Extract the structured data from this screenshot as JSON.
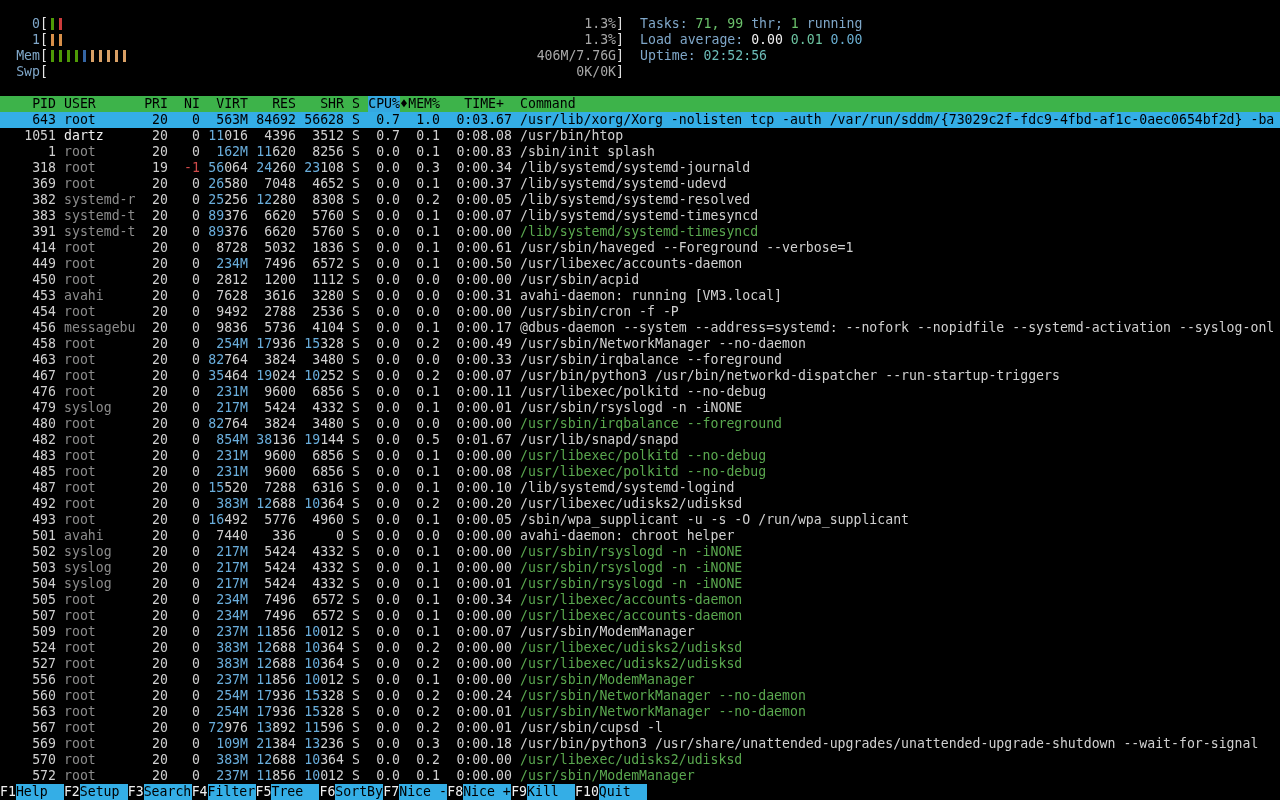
{
  "meters": [
    {
      "label": "0",
      "bars": [
        {
          "color": "#4e9a06"
        },
        {
          "color": "#cc3b3b"
        }
      ],
      "reading": "1.3%"
    },
    {
      "label": "1",
      "bars": [
        {
          "color": "#d9904a"
        },
        {
          "color": "#d9904a"
        }
      ],
      "reading": "1.3%"
    },
    {
      "label": "Mem",
      "bars": [
        {
          "color": "#4e9a06"
        },
        {
          "color": "#4e9a06"
        },
        {
          "color": "#4e9a06"
        },
        {
          "color": "#4e9a06"
        },
        {
          "color": "#3465a4"
        },
        {
          "color": "#d9a066"
        },
        {
          "color": "#d9a066"
        },
        {
          "color": "#d9a066"
        },
        {
          "color": "#d9a066"
        },
        {
          "color": "#d9a066"
        }
      ],
      "reading": "406M/7.76G"
    },
    {
      "label": "Swp",
      "reading": "0K/0K"
    }
  ],
  "bracket_open": "[",
  "bracket_close": "]",
  "stats": [
    [
      {
        "text": "Tasks: ",
        "color": "#7fa7c9"
      },
      {
        "text": "71, 99",
        "color": "#6cc36c"
      },
      {
        "text": " thr; ",
        "color": "#7fa7c9"
      },
      {
        "text": "1",
        "color": "#6cc36c"
      },
      {
        "text": " running",
        "color": "#7fa7c9"
      }
    ],
    [
      {
        "text": "Load average: ",
        "color": "#7fa7c9"
      },
      {
        "text": "0.00 ",
        "color": "#f0f0f0"
      },
      {
        "text": "0.01 ",
        "color": "#6cc3a0"
      },
      {
        "text": "0.00",
        "color": "#6aaed0"
      }
    ],
    [
      {
        "text": "Uptime: ",
        "color": "#7fa7c9"
      },
      {
        "text": "02:52:56",
        "color": "#6cbcb8"
      }
    ]
  ],
  "columns": [
    {
      "label": "PID",
      "sorted": false
    },
    {
      "label": "USER",
      "sorted": false
    },
    {
      "label": "PRI",
      "sorted": false
    },
    {
      "label": "NI",
      "sorted": false
    },
    {
      "label": "VIRT",
      "sorted": false
    },
    {
      "label": "RES",
      "sorted": false
    },
    {
      "label": "SHR",
      "sorted": false
    },
    {
      "label": "S",
      "sorted": false
    },
    {
      "label": "CPU%",
      "sorted": true
    },
    {
      "label": "MEM%",
      "sorted": false
    },
    {
      "label": "TIME+",
      "sorted": false
    },
    {
      "label": "Command",
      "sorted": false
    }
  ],
  "sort_indicator": "♦",
  "rows": [
    {
      "cells": [
        "643",
        "root",
        "20",
        "0",
        "563M",
        "84692",
        "56628",
        "S",
        "0.7",
        "1.0",
        "0:03.67",
        "/usr/lib/xorg/Xorg -nolisten tcp -auth /var/run/sddm/{73029c2f-fdc9-4fbd-af1c-0aec0654bf2d} -ba"
      ],
      "selected": true
    },
    {
      "cells": [
        "1051",
        "dartz",
        "20",
        "0",
        "11016",
        "4396",
        "3512",
        "S",
        "0.7",
        "0.1",
        "0:08.08",
        "/usr/bin/htop"
      ],
      "selected": false,
      "own": true,
      "thread": false,
      "niced": false
    },
    {
      "cells": [
        "1",
        "root",
        "20",
        "0",
        "162M",
        "11620",
        "8256",
        "S",
        "0.0",
        "0.1",
        "0:00.83",
        "/sbin/init splash"
      ],
      "selected": false,
      "own": false,
      "thread": false,
      "niced": false
    },
    {
      "cells": [
        "318",
        "root",
        "19",
        "-1",
        "56064",
        "24260",
        "23108",
        "S",
        "0.0",
        "0.3",
        "0:00.34",
        "/lib/systemd/systemd-journald"
      ],
      "selected": false,
      "own": false,
      "thread": false,
      "niced": true
    },
    {
      "cells": [
        "369",
        "root",
        "20",
        "0",
        "26580",
        "7048",
        "4652",
        "S",
        "0.0",
        "0.1",
        "0:00.37",
        "/lib/systemd/systemd-udevd"
      ],
      "selected": false,
      "own": false,
      "thread": false,
      "niced": false
    },
    {
      "cells": [
        "382",
        "systemd-r",
        "20",
        "0",
        "25256",
        "12280",
        "8308",
        "S",
        "0.0",
        "0.2",
        "0:00.05",
        "/lib/systemd/systemd-resolved"
      ],
      "selected": false,
      "own": false,
      "thread": false,
      "niced": false
    },
    {
      "cells": [
        "383",
        "systemd-t",
        "20",
        "0",
        "89376",
        "6620",
        "5760",
        "S",
        "0.0",
        "0.1",
        "0:00.07",
        "/lib/systemd/systemd-timesyncd"
      ],
      "selected": false,
      "own": false,
      "thread": false,
      "niced": false
    },
    {
      "cells": [
        "391",
        "systemd-t",
        "20",
        "0",
        "89376",
        "6620",
        "5760",
        "S",
        "0.0",
        "0.1",
        "0:00.00",
        "/lib/systemd/systemd-timesyncd"
      ],
      "selected": false,
      "own": false,
      "thread": true,
      "niced": false
    },
    {
      "cells": [
        "414",
        "root",
        "20",
        "0",
        "8728",
        "5032",
        "1836",
        "S",
        "0.0",
        "0.1",
        "0:00.61",
        "/usr/sbin/haveged --Foreground --verbose=1"
      ],
      "selected": false,
      "own": false,
      "thread": false,
      "niced": false
    },
    {
      "cells": [
        "449",
        "root",
        "20",
        "0",
        "234M",
        "7496",
        "6572",
        "S",
        "0.0",
        "0.1",
        "0:00.50",
        "/usr/libexec/accounts-daemon"
      ],
      "selected": false,
      "own": false,
      "thread": false,
      "niced": false
    },
    {
      "cells": [
        "450",
        "root",
        "20",
        "0",
        "2812",
        "1200",
        "1112",
        "S",
        "0.0",
        "0.0",
        "0:00.00",
        "/usr/sbin/acpid"
      ],
      "selected": false,
      "own": false,
      "thread": false,
      "niced": false
    },
    {
      "cells": [
        "453",
        "avahi",
        "20",
        "0",
        "7628",
        "3616",
        "3280",
        "S",
        "0.0",
        "0.0",
        "0:00.31",
        "avahi-daemon: running [VM3.local]"
      ],
      "selected": false,
      "own": false,
      "thread": false,
      "niced": false
    },
    {
      "cells": [
        "454",
        "root",
        "20",
        "0",
        "9492",
        "2788",
        "2536",
        "S",
        "0.0",
        "0.0",
        "0:00.00",
        "/usr/sbin/cron -f -P"
      ],
      "selected": false,
      "own": false,
      "thread": false,
      "niced": false
    },
    {
      "cells": [
        "456",
        "messagebu",
        "20",
        "0",
        "9836",
        "5736",
        "4104",
        "S",
        "0.0",
        "0.1",
        "0:00.17",
        "@dbus-daemon --system --address=systemd: --nofork --nopidfile --systemd-activation --syslog-onl"
      ],
      "selected": false,
      "own": false,
      "thread": false,
      "niced": false
    },
    {
      "cells": [
        "458",
        "root",
        "20",
        "0",
        "254M",
        "17936",
        "15328",
        "S",
        "0.0",
        "0.2",
        "0:00.49",
        "/usr/sbin/NetworkManager --no-daemon"
      ],
      "selected": false,
      "own": false,
      "thread": false,
      "niced": false
    },
    {
      "cells": [
        "463",
        "root",
        "20",
        "0",
        "82764",
        "3824",
        "3480",
        "S",
        "0.0",
        "0.0",
        "0:00.33",
        "/usr/sbin/irqbalance --foreground"
      ],
      "selected": false,
      "own": false,
      "thread": false,
      "niced": false
    },
    {
      "cells": [
        "467",
        "root",
        "20",
        "0",
        "35464",
        "19024",
        "10252",
        "S",
        "0.0",
        "0.2",
        "0:00.07",
        "/usr/bin/python3 /usr/bin/networkd-dispatcher --run-startup-triggers"
      ],
      "selected": false,
      "own": false,
      "thread": false,
      "niced": false
    },
    {
      "cells": [
        "476",
        "root",
        "20",
        "0",
        "231M",
        "9600",
        "6856",
        "S",
        "0.0",
        "0.1",
        "0:00.11",
        "/usr/libexec/polkitd --no-debug"
      ],
      "selected": false,
      "own": false,
      "thread": false,
      "niced": false
    },
    {
      "cells": [
        "479",
        "syslog",
        "20",
        "0",
        "217M",
        "5424",
        "4332",
        "S",
        "0.0",
        "0.1",
        "0:00.01",
        "/usr/sbin/rsyslogd -n -iNONE"
      ],
      "selected": false,
      "own": false,
      "thread": false,
      "niced": false
    },
    {
      "cells": [
        "480",
        "root",
        "20",
        "0",
        "82764",
        "3824",
        "3480",
        "S",
        "0.0",
        "0.0",
        "0:00.00",
        "/usr/sbin/irqbalance --foreground"
      ],
      "selected": false,
      "own": false,
      "thread": true,
      "niced": false
    },
    {
      "cells": [
        "482",
        "root",
        "20",
        "0",
        "854M",
        "38136",
        "19144",
        "S",
        "0.0",
        "0.5",
        "0:01.67",
        "/usr/lib/snapd/snapd"
      ],
      "selected": false,
      "own": false,
      "thread": false,
      "niced": false
    },
    {
      "cells": [
        "483",
        "root",
        "20",
        "0",
        "231M",
        "9600",
        "6856",
        "S",
        "0.0",
        "0.1",
        "0:00.00",
        "/usr/libexec/polkitd --no-debug"
      ],
      "selected": false,
      "own": false,
      "thread": true,
      "niced": false
    },
    {
      "cells": [
        "485",
        "root",
        "20",
        "0",
        "231M",
        "9600",
        "6856",
        "S",
        "0.0",
        "0.1",
        "0:00.08",
        "/usr/libexec/polkitd --no-debug"
      ],
      "selected": false,
      "own": false,
      "thread": true,
      "niced": false
    },
    {
      "cells": [
        "487",
        "root",
        "20",
        "0",
        "15520",
        "7288",
        "6316",
        "S",
        "0.0",
        "0.1",
        "0:00.10",
        "/lib/systemd/systemd-logind"
      ],
      "selected": false,
      "own": false,
      "thread": false,
      "niced": false
    },
    {
      "cells": [
        "492",
        "root",
        "20",
        "0",
        "383M",
        "12688",
        "10364",
        "S",
        "0.0",
        "0.2",
        "0:00.20",
        "/usr/libexec/udisks2/udisksd"
      ],
      "selected": false,
      "own": false,
      "thread": false,
      "niced": false
    },
    {
      "cells": [
        "493",
        "root",
        "20",
        "0",
        "16492",
        "5776",
        "4960",
        "S",
        "0.0",
        "0.1",
        "0:00.05",
        "/sbin/wpa_supplicant -u -s -O /run/wpa_supplicant"
      ],
      "selected": false,
      "own": false,
      "thread": false,
      "niced": false
    },
    {
      "cells": [
        "501",
        "avahi",
        "20",
        "0",
        "7440",
        "336",
        "0",
        "S",
        "0.0",
        "0.0",
        "0:00.00",
        "avahi-daemon: chroot helper"
      ],
      "selected": false,
      "own": false,
      "thread": false,
      "niced": false
    },
    {
      "cells": [
        "502",
        "syslog",
        "20",
        "0",
        "217M",
        "5424",
        "4332",
        "S",
        "0.0",
        "0.1",
        "0:00.00",
        "/usr/sbin/rsyslogd -n -iNONE"
      ],
      "selected": false,
      "own": false,
      "thread": true,
      "niced": false
    },
    {
      "cells": [
        "503",
        "syslog",
        "20",
        "0",
        "217M",
        "5424",
        "4332",
        "S",
        "0.0",
        "0.1",
        "0:00.00",
        "/usr/sbin/rsyslogd -n -iNONE"
      ],
      "selected": false,
      "own": false,
      "thread": true,
      "niced": false
    },
    {
      "cells": [
        "504",
        "syslog",
        "20",
        "0",
        "217M",
        "5424",
        "4332",
        "S",
        "0.0",
        "0.1",
        "0:00.01",
        "/usr/sbin/rsyslogd -n -iNONE"
      ],
      "selected": false,
      "own": false,
      "thread": true,
      "niced": false
    },
    {
      "cells": [
        "505",
        "root",
        "20",
        "0",
        "234M",
        "7496",
        "6572",
        "S",
        "0.0",
        "0.1",
        "0:00.34",
        "/usr/libexec/accounts-daemon"
      ],
      "selected": false,
      "own": false,
      "thread": true,
      "niced": false
    },
    {
      "cells": [
        "507",
        "root",
        "20",
        "0",
        "234M",
        "7496",
        "6572",
        "S",
        "0.0",
        "0.1",
        "0:00.00",
        "/usr/libexec/accounts-daemon"
      ],
      "selected": false,
      "own": false,
      "thread": true,
      "niced": false
    },
    {
      "cells": [
        "509",
        "root",
        "20",
        "0",
        "237M",
        "11856",
        "10012",
        "S",
        "0.0",
        "0.1",
        "0:00.07",
        "/usr/sbin/ModemManager"
      ],
      "selected": false,
      "own": false,
      "thread": false,
      "niced": false
    },
    {
      "cells": [
        "524",
        "root",
        "20",
        "0",
        "383M",
        "12688",
        "10364",
        "S",
        "0.0",
        "0.2",
        "0:00.00",
        "/usr/libexec/udisks2/udisksd"
      ],
      "selected": false,
      "own": false,
      "thread": true,
      "niced": false
    },
    {
      "cells": [
        "527",
        "root",
        "20",
        "0",
        "383M",
        "12688",
        "10364",
        "S",
        "0.0",
        "0.2",
        "0:00.00",
        "/usr/libexec/udisks2/udisksd"
      ],
      "selected": false,
      "own": false,
      "thread": true,
      "niced": false
    },
    {
      "cells": [
        "556",
        "root",
        "20",
        "0",
        "237M",
        "11856",
        "10012",
        "S",
        "0.0",
        "0.1",
        "0:00.00",
        "/usr/sbin/ModemManager"
      ],
      "selected": false,
      "own": false,
      "thread": true,
      "niced": false
    },
    {
      "cells": [
        "560",
        "root",
        "20",
        "0",
        "254M",
        "17936",
        "15328",
        "S",
        "0.0",
        "0.2",
        "0:00.24",
        "/usr/sbin/NetworkManager --no-daemon"
      ],
      "selected": false,
      "own": false,
      "thread": true,
      "niced": false
    },
    {
      "cells": [
        "563",
        "root",
        "20",
        "0",
        "254M",
        "17936",
        "15328",
        "S",
        "0.0",
        "0.2",
        "0:00.01",
        "/usr/sbin/NetworkManager --no-daemon"
      ],
      "selected": false,
      "own": false,
      "thread": true,
      "niced": false
    },
    {
      "cells": [
        "567",
        "root",
        "20",
        "0",
        "72976",
        "13892",
        "11596",
        "S",
        "0.0",
        "0.2",
        "0:00.01",
        "/usr/sbin/cupsd -l"
      ],
      "selected": false,
      "own": false,
      "thread": false,
      "niced": false
    },
    {
      "cells": [
        "569",
        "root",
        "20",
        "0",
        "109M",
        "21384",
        "13236",
        "S",
        "0.0",
        "0.3",
        "0:00.18",
        "/usr/bin/python3 /usr/share/unattended-upgrades/unattended-upgrade-shutdown --wait-for-signal"
      ],
      "selected": false,
      "own": false,
      "thread": false,
      "niced": false
    },
    {
      "cells": [
        "570",
        "root",
        "20",
        "0",
        "383M",
        "12688",
        "10364",
        "S",
        "0.0",
        "0.2",
        "0:00.00",
        "/usr/libexec/udisks2/udisksd"
      ],
      "selected": false,
      "own": false,
      "thread": true,
      "niced": false
    },
    {
      "cells": [
        "572",
        "root",
        "20",
        "0",
        "237M",
        "11856",
        "10012",
        "S",
        "0.0",
        "0.1",
        "0:00.00",
        "/usr/sbin/ModemManager"
      ],
      "selected": false,
      "own": false,
      "thread": true,
      "niced": false
    }
  ],
  "function_keys": [
    {
      "key": "F1",
      "label": "Help"
    },
    {
      "key": "F2",
      "label": "Setup"
    },
    {
      "key": "F3",
      "label": "Search"
    },
    {
      "key": "F4",
      "label": "Filter"
    },
    {
      "key": "F5",
      "label": "Tree"
    },
    {
      "key": "F6",
      "label": "SortBy"
    },
    {
      "key": "F7",
      "label": "Nice -"
    },
    {
      "key": "F8",
      "label": "Nice +"
    },
    {
      "key": "F9",
      "label": "Kill"
    },
    {
      "key": "F10",
      "label": "Quit"
    }
  ]
}
